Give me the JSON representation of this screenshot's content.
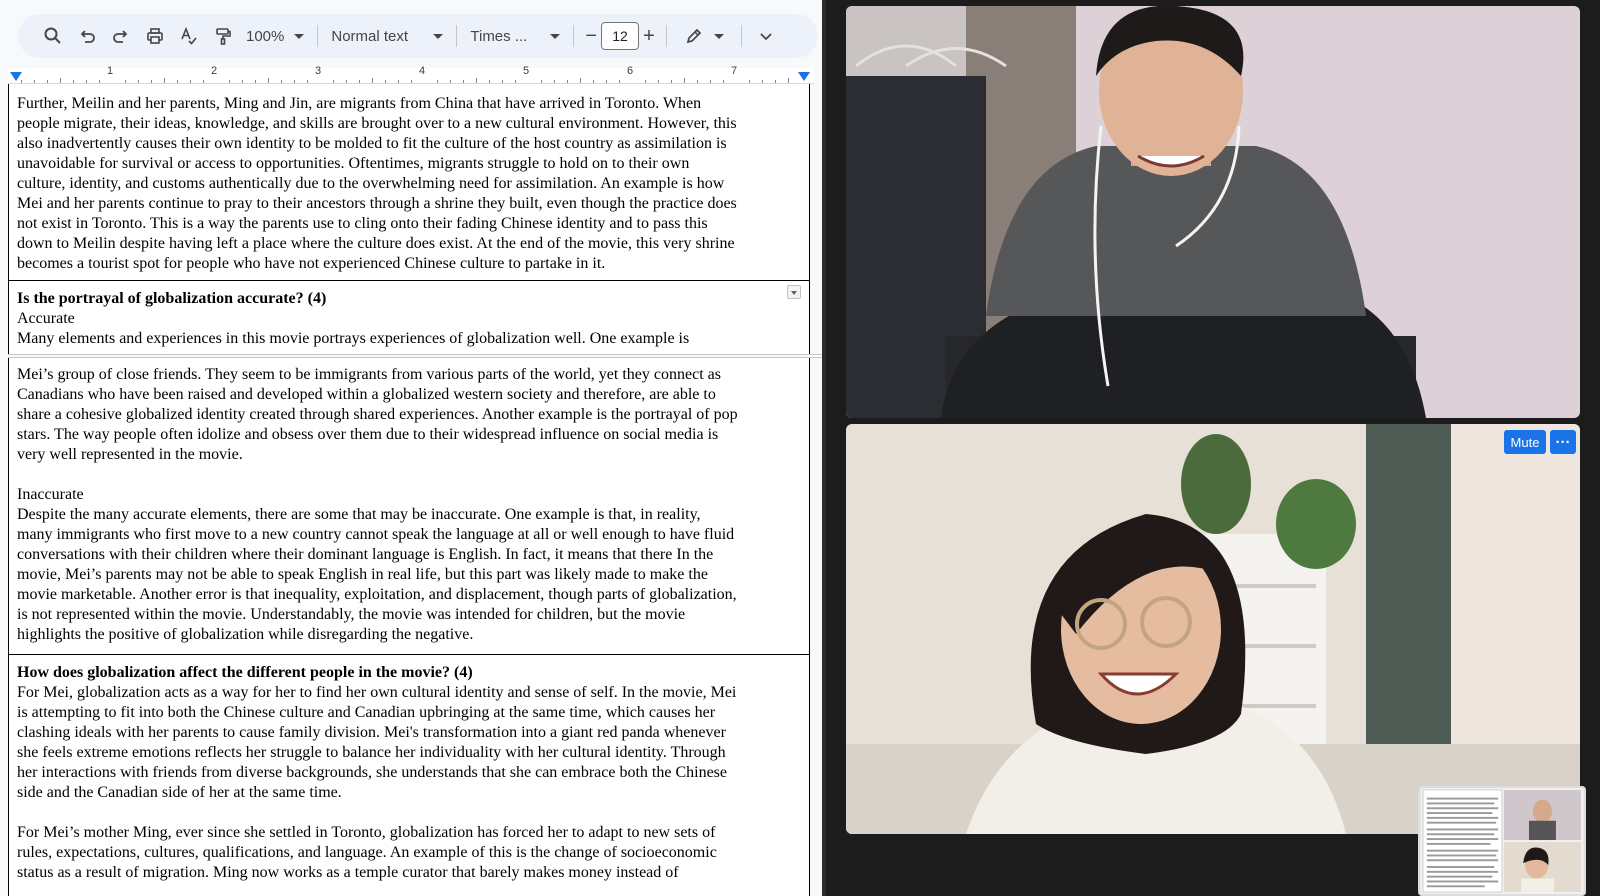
{
  "toolbar": {
    "icons": [
      "search-icon",
      "undo-icon",
      "redo-icon",
      "print-icon",
      "spellcheck-icon",
      "paint-format-icon"
    ],
    "zoom": "100%",
    "style": "Normal text",
    "font": "Times ...",
    "font_size_minus": "−",
    "font_size": "12",
    "font_size_plus": "+"
  },
  "ruler": {
    "numbers": [
      "1",
      "2",
      "3",
      "4",
      "5",
      "6",
      "7"
    ]
  },
  "document": {
    "para1": [
      "Further, Meilin and her parents, Ming and Jin, are migrants from China that have arrived in Toronto. When",
      "people migrate, their ideas, knowledge, and skills are brought over to a new cultural environment. However, this",
      "also inadvertently causes their own identity to be molded to fit the culture of the host country as assimilation is",
      "unavoidable for survival or access to opportunities. Oftentimes, migrants struggle to hold on to their own",
      "culture, identity, and customs authentically due to the overwhelming need for assimilation. An example is how",
      "Mei and her parents continue to pray to their ancestors through a shrine they built, even though the practice does",
      "not exist in Toronto. This is a way the parents use to cling onto their fading Chinese identity and to pass this",
      "down to Meilin despite having left a place where the culture does exist. At the end of the movie, this very shrine",
      "becomes a tourist spot for people who have not experienced Chinese culture to partake in it."
    ],
    "q2_heading": "Is the portrayal of globalization accurate? (4)",
    "q2_accurate_label": "Accurate",
    "q2_line1": "Many elements and experiences in this movie portrays experiences of globalization well. One example is",
    "q2_accurate_cont": [
      "Mei’s group of close friends. They seem to be immigrants from various parts of the world, yet they connect as",
      "Canadians who have been raised and developed within a globalized western society and therefore, are able to",
      "share a cohesive globalized identity created through shared experiences. Another example is the portrayal of pop",
      "stars. The way people often idolize and obsess over them due to their widespread influence on social media is",
      "very well represented in the movie."
    ],
    "q2_inaccurate_label": "Inaccurate",
    "q2_inaccurate": [
      "Despite the many accurate elements, there are some that may be inaccurate. One example is that, in reality,",
      "many immigrants who first move to a new country cannot speak the language at all or well enough to have fluid",
      "conversations with their children where their dominant language is English. In fact, it means that there  In the",
      "movie, Mei’s parents may not be able to speak English in real life, but this part was likely made to make the",
      "movie marketable. Another error is that inequality, exploitation, and displacement, though parts of globalization,",
      "is not represented within the movie. Understandably, the movie was intended for children, but the movie",
      "highlights the positive of globalization while disregarding the negative."
    ],
    "q3_heading": "How does globalization affect the different people in the movie? (4)",
    "q3_mei": [
      "For Mei, globalization acts as a way for her to find her own cultural identity and sense of self. In the movie, Mei",
      "is attempting to fit into both the Chinese culture and Canadian upbringing at the same time, which causes her",
      "clashing ideals with her parents to cause family division. Mei's transformation into a giant red panda whenever",
      "she feels extreme emotions reflects her struggle to balance her individuality with her cultural identity. Through",
      "her interactions with friends from diverse backgrounds, she understands that she can embrace both the Chinese",
      "side and the Canadian side of her at the same time."
    ],
    "q3_ming": [
      "For Mei’s mother Ming, ever since she settled in Toronto, globalization has forced her to adapt to new sets of",
      "rules, expectations, cultures, qualifications, and language. An example of this is the change of socioeconomic",
      "status as a result of migration. Ming now works as a temple curator that barely makes money instead of"
    ]
  },
  "call": {
    "mute_label": "Mute",
    "more_label": "···",
    "colors": {
      "accent": "#1a73e8",
      "background": "#1c1c1c"
    }
  }
}
